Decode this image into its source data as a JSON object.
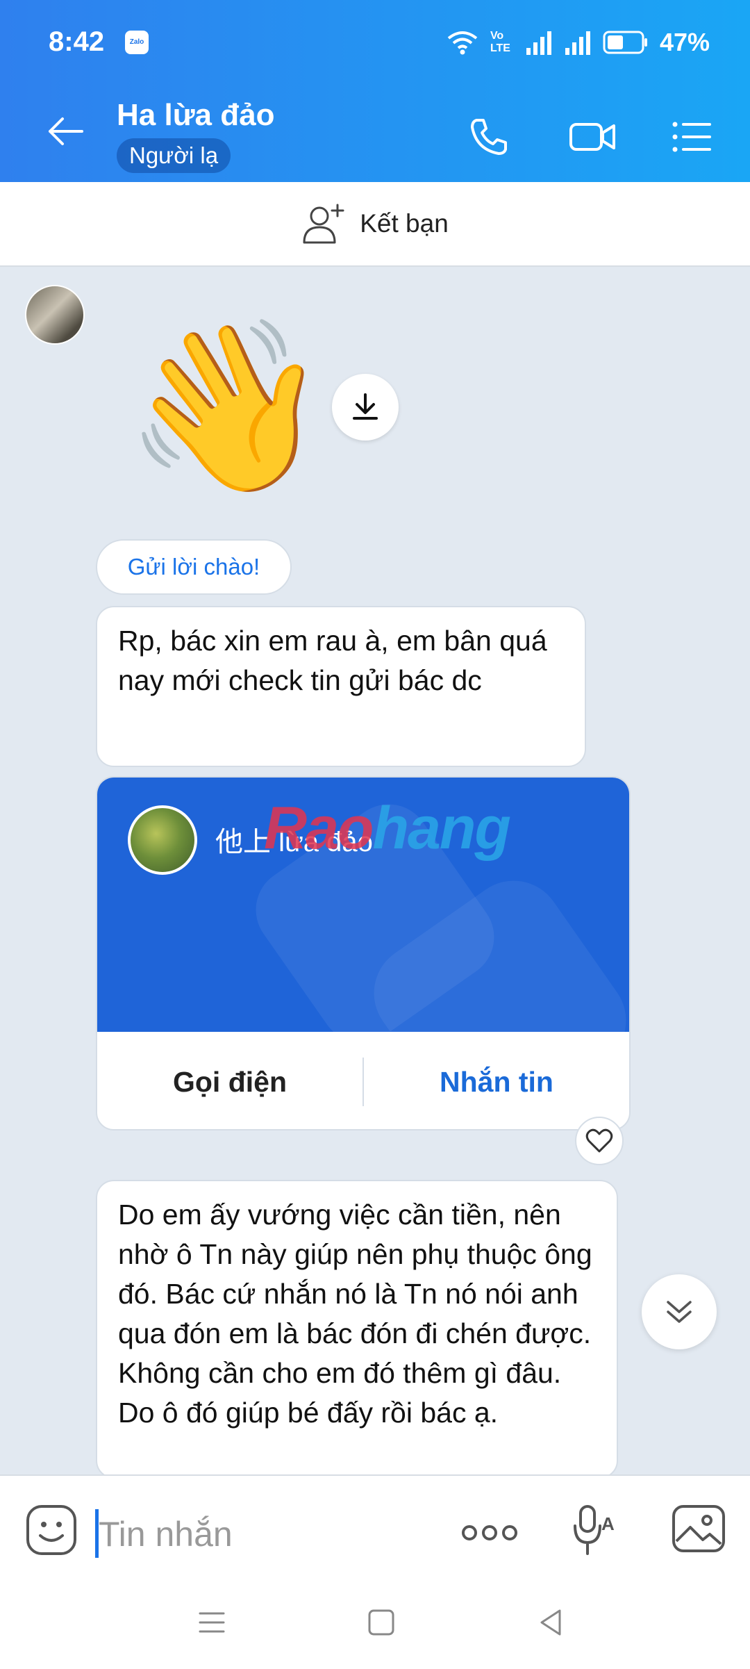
{
  "status_bar": {
    "time": "8:42",
    "app_badge": "Zalo",
    "network_label": "Vo LTE",
    "battery": "47%"
  },
  "header": {
    "title": "Ha lừa đảo",
    "badge": "Người lạ"
  },
  "friend_bar": {
    "label": "Kết bạn"
  },
  "messages": {
    "greet_label": "Gửi lời chào!",
    "bubble1": "Rp, bác xin em rau à, em bân quá nay mới check tin gửi bác dc",
    "card": {
      "name": "他上 lừa đảo",
      "watermark_a": "Rao",
      "watermark_b": "hang",
      "call_label": "Gọi điện",
      "message_label": "Nhắn tin"
    },
    "bubble2": "Do em ấy vướng việc cần tiền, nên nhờ ô Tn này giúp nên phụ thuộc ông đó. Bác cứ nhắn nó là Tn nó nói anh qua đón em là bác đón đi chén được. Không cần cho em đó thêm gì đâu. Do ô đó giúp bé đấy rồi bác ạ."
  },
  "input": {
    "placeholder": "Tin nhắn"
  },
  "colors": {
    "header_start": "#2f80ee",
    "header_end": "#1aa6f5",
    "accent": "#1a73e8",
    "card_bg": "#1f64d8",
    "chat_bg": "#e2e9f1"
  },
  "icons": [
    "back-arrow-icon",
    "phone-icon",
    "video-camera-icon",
    "menu-list-icon",
    "add-friend-icon",
    "download-icon",
    "heart-icon",
    "double-chevron-down-icon",
    "emoji-icon",
    "more-dots-icon",
    "voice-icon",
    "image-gallery-icon"
  ]
}
